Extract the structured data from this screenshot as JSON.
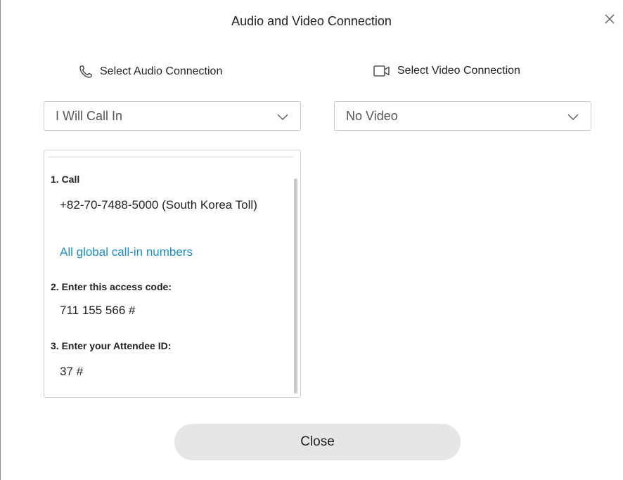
{
  "dialog": {
    "title": "Audio and Video Connection",
    "close_icon": "close-icon"
  },
  "audio": {
    "label": "Select Audio Connection",
    "icon": "phone-icon",
    "selected": "I Will Call In"
  },
  "video": {
    "label": "Select Video Connection",
    "icon": "video-camera-icon",
    "selected": "No Video"
  },
  "instructions": {
    "step1_title": "1. Call",
    "phone_number": "+82-70-7488-5000 (South Korea Toll)",
    "global_link": "All global call-in numbers",
    "step2_title": "2. Enter this access code:",
    "access_code": "711 155 566 #",
    "step3_title": "3. Enter your Attendee ID:",
    "attendee_id": "37 #"
  },
  "footer": {
    "close_label": "Close"
  },
  "colors": {
    "link": "#1a8fc9",
    "button_bg": "#e6e6e6",
    "border": "#c8c8c8"
  }
}
